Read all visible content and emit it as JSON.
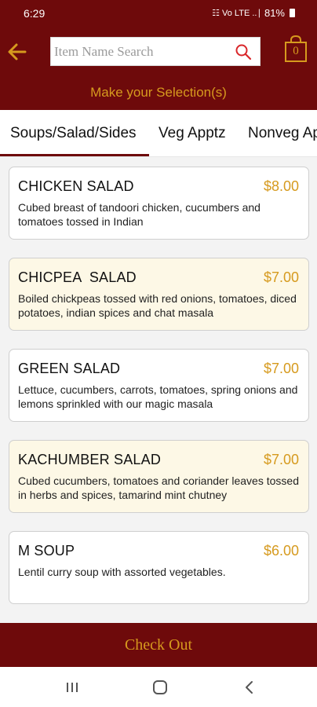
{
  "status_bar": {
    "time": "6:29",
    "signal_text": "☷ Vo LTE ..∣",
    "battery": "81%"
  },
  "header": {
    "search_placeholder": "Item Name Search",
    "cart_count": "0",
    "icons": [
      "back-arrow-icon",
      "search-icon",
      "shopping-bag-icon"
    ]
  },
  "subheader": {
    "title": "Make your Selection(s)"
  },
  "tabs": [
    {
      "label": "Soups/Salad/Sides",
      "selected": true
    },
    {
      "label": "Veg Apptz",
      "selected": false
    },
    {
      "label": "Nonveg Apptz",
      "selected": false
    }
  ],
  "menu_items": [
    {
      "name": "CHICKEN SALAD",
      "price": "$8.00",
      "description": "Cubed breast of tandoori chicken, cucumbers and tomatoes tossed in Indian"
    },
    {
      "name": "CHICPEA  SALAD",
      "price": "$7.00",
      "description": "Boiled chickpeas tossed with red onions, tomatoes, diced potatoes, indian spices and chat masala"
    },
    {
      "name": "GREEN SALAD",
      "price": "$7.00",
      "description": "Lettuce, cucumbers, carrots, tomatoes, spring onions and lemons sprinkled with our magic masala"
    },
    {
      "name": "KACHUMBER SALAD",
      "price": "$7.00",
      "description": "Cubed cucumbers, tomatoes and coriander leaves tossed in herbs and spices, tamarind mint chutney"
    },
    {
      "name": "M SOUP",
      "price": "$6.00",
      "description": "Lentil curry soup with assorted vegetables."
    }
  ],
  "checkout": {
    "label": "Check Out"
  },
  "nav_bar": {
    "icons": [
      "recent-apps-icon",
      "home-icon",
      "back-icon"
    ]
  },
  "colors": {
    "brand_maroon": "#6e0a0b",
    "accent_gold": "#d69a1e",
    "alt_card_bg": "#fdf8e6"
  }
}
